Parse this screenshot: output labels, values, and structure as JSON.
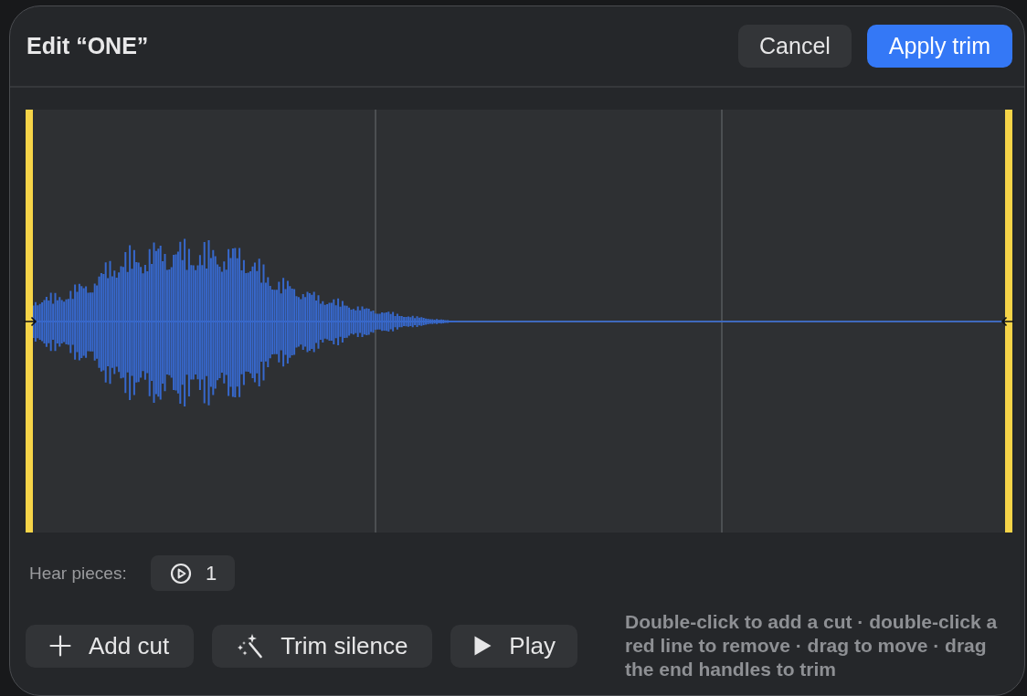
{
  "dialog": {
    "title": "Edit “ONE”",
    "buttons": [
      {
        "label": "Cancel",
        "kind": "secondary"
      },
      {
        "label": "Apply trim",
        "kind": "primary"
      }
    ]
  },
  "hear_pieces": {
    "label": "Hear pieces:",
    "pieces": [
      {
        "label": "1"
      }
    ]
  },
  "actions": [
    {
      "label": "Add cut",
      "kind": "add"
    },
    {
      "label": "Trim silence",
      "kind": "magic"
    },
    {
      "label": "Play",
      "kind": "play"
    }
  ],
  "hint": "Double-click to add a cut · double-click a red line to remove · drag to move · drag the end handles to trim"
}
